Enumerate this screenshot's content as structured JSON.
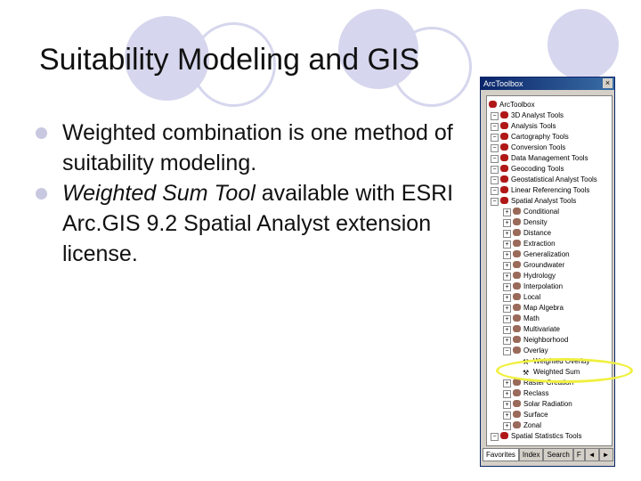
{
  "slide": {
    "title": "Suitability Modeling and GIS",
    "bullets": [
      {
        "plain": "Weighted combination is one method of suitability modeling."
      },
      {
        "italic": "Weighted Sum Tool",
        "plain": " available with ESRI Arc.GIS 9.2 Spatial Analyst extension license."
      }
    ]
  },
  "toolbox": {
    "title": "ArcToolbox",
    "close": "×",
    "root": "ArcToolbox",
    "toolsets": [
      "3D Analyst Tools",
      "Analysis Tools",
      "Cartography Tools",
      "Conversion Tools",
      "Data Management Tools",
      "Geocoding Tools",
      "Geostatistical Analyst Tools",
      "Linear Referencing Tools",
      "Spatial Analyst Tools"
    ],
    "spatial": [
      "Conditional",
      "Density",
      "Distance",
      "Extraction",
      "Generalization",
      "Groundwater",
      "Hydrology",
      "Interpolation",
      "Local",
      "Map Algebra",
      "Math",
      "Multivariate",
      "Neighborhood",
      "Overlay"
    ],
    "overlay_tools": [
      "Weighted Overlay",
      "Weighted Sum"
    ],
    "spatial_after": [
      "Raster Creation",
      "Reclass",
      "Solar Radiation",
      "Surface",
      "Zonal"
    ],
    "last": "Spatial Statistics Tools",
    "tabs": [
      "Favorites",
      "Index",
      "Search",
      "F"
    ],
    "scroll_left": "◄",
    "scroll_right": "►"
  }
}
